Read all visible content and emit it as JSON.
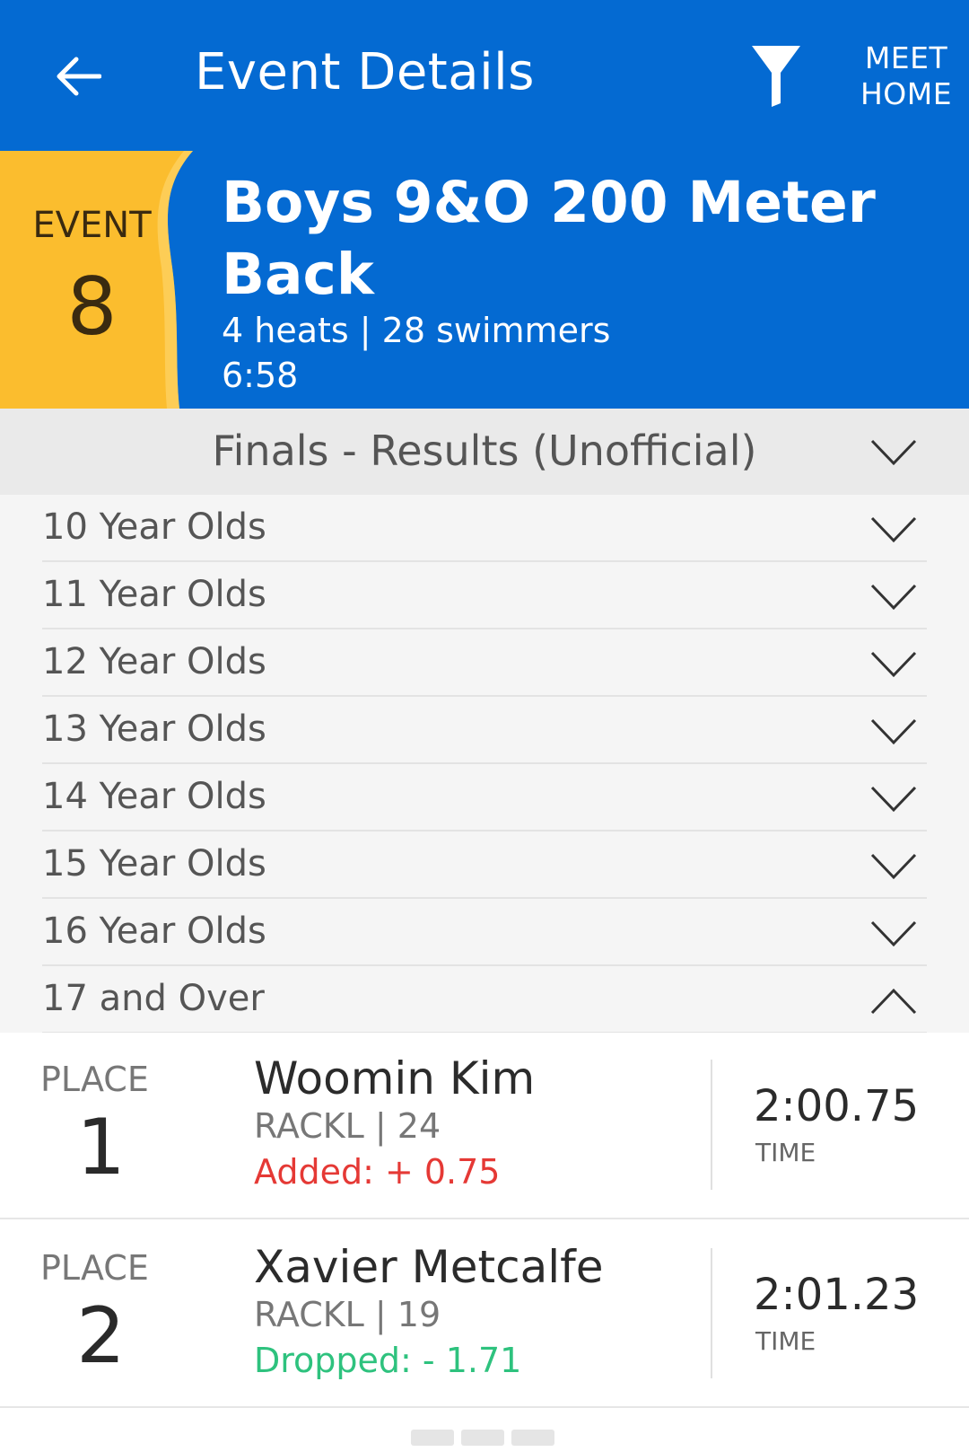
{
  "appbar": {
    "title": "Event Details",
    "meet_home_line1": "MEET",
    "meet_home_line2": "HOME"
  },
  "event": {
    "label": "EVENT",
    "number": "8",
    "title": "Boys 9&O 200 Meter Back",
    "summary": "4 heats | 28 swimmers",
    "time": "6:58"
  },
  "section": {
    "title": "Finals - Results (Unofficial)"
  },
  "age_groups": [
    {
      "label": "10 Year Olds",
      "expanded": false
    },
    {
      "label": "11 Year Olds",
      "expanded": false
    },
    {
      "label": "12 Year Olds",
      "expanded": false
    },
    {
      "label": "13 Year Olds",
      "expanded": false
    },
    {
      "label": "14 Year Olds",
      "expanded": false
    },
    {
      "label": "15 Year Olds",
      "expanded": false
    },
    {
      "label": "16 Year Olds",
      "expanded": false
    },
    {
      "label": "17 and Over",
      "expanded": true
    }
  ],
  "results": [
    {
      "place_label": "PLACE",
      "place": "1",
      "name": "Woomin Kim",
      "team": "RACKL | 24",
      "diff": "Added: + 0.75",
      "diff_type": "added",
      "time": "2:00.75",
      "time_label": "TIME"
    },
    {
      "place_label": "PLACE",
      "place": "2",
      "name": "Xavier Metcalfe",
      "team": "RACKL | 19",
      "diff": "Dropped: - 1.71",
      "diff_type": "dropped",
      "time": "2:01.23",
      "time_label": "TIME"
    }
  ],
  "colors": {
    "primary": "#046ad2",
    "badge": "#fbbd2e",
    "added": "#e53935",
    "dropped": "#2ec27e"
  }
}
